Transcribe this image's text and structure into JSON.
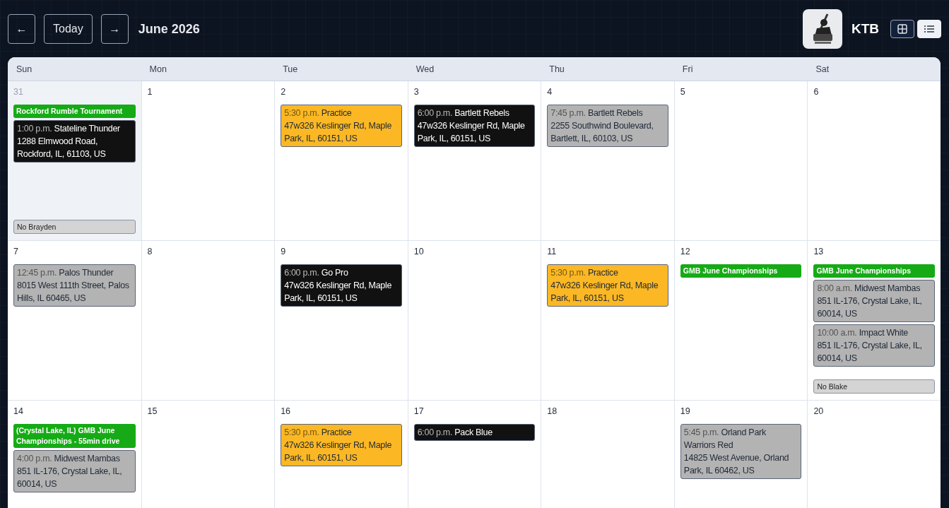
{
  "toolbar": {
    "prev": "←",
    "today": "Today",
    "next": "→",
    "title": "June 2026"
  },
  "team": {
    "name": "KTB"
  },
  "views": [
    {
      "kind": "grid",
      "selected": false
    },
    {
      "kind": "list",
      "selected": true
    }
  ],
  "weekdays": [
    "Sun",
    "Mon",
    "Tue",
    "Wed",
    "Thu",
    "Fri",
    "Sat"
  ],
  "weeks": [
    {
      "days": [
        {
          "day": "31",
          "outside": true,
          "events": [
            {
              "kind": "allday",
              "color": "#16ab16",
              "title": "Rockford Rumble Tournament"
            },
            {
              "kind": "timed",
              "color": "#111111",
              "time": "1:00 p.m.",
              "title": "Stateline Thunder",
              "address": "1288 Elmwood Road, Rockford, IL, 61103, US"
            },
            {
              "kind": "note",
              "title": "No Brayden"
            }
          ]
        },
        {
          "day": "1",
          "outside": false
        },
        {
          "day": "2",
          "outside": false,
          "events": [
            {
              "kind": "timed",
              "color": "#fbb824",
              "time": "5:30 p.m.",
              "title": "Practice",
              "address": "47w326 Keslinger Rd, Maple Park, IL, 60151, US"
            }
          ]
        },
        {
          "day": "3",
          "outside": false,
          "events": [
            {
              "kind": "timed",
              "color": "#111111",
              "time": "6:00 p.m.",
              "title": "Bartlett Rebels",
              "address": "47w326 Keslinger Rd, Maple Park, IL, 60151, US"
            }
          ]
        },
        {
          "day": "4",
          "outside": false,
          "events": [
            {
              "kind": "timed",
              "color": "#b3b3b3",
              "time": "7:45 p.m.",
              "title": "Bartlett Rebels",
              "address": "2255 Southwind Boulevard, Bartlett, IL, 60103, US"
            }
          ]
        },
        {
          "day": "5",
          "outside": false
        },
        {
          "day": "6",
          "outside": false
        }
      ]
    },
    {
      "days": [
        {
          "day": "7",
          "outside": false,
          "events": [
            {
              "kind": "timed",
              "color": "#b3b3b3",
              "time": "12:45 p.m.",
              "title": "Palos Thunder",
              "address": "8015 West 111th Street, Palos Hills, IL 60465, US"
            }
          ]
        },
        {
          "day": "8",
          "outside": false
        },
        {
          "day": "9",
          "outside": false,
          "events": [
            {
              "kind": "timed",
              "color": "#111111",
              "time": "6:00 p.m.",
              "title": "Go Pro",
              "address": "47w326 Keslinger Rd, Maple Park, IL, 60151, US"
            }
          ]
        },
        {
          "day": "10",
          "outside": false
        },
        {
          "day": "11",
          "outside": false,
          "events": [
            {
              "kind": "timed",
              "color": "#fbb824",
              "time": "5:30 p.m.",
              "title": "Practice",
              "address": "47w326 Keslinger Rd, Maple Park, IL, 60151, US"
            }
          ]
        },
        {
          "day": "12",
          "outside": false,
          "events": [
            {
              "kind": "allday",
              "color": "#16ab16",
              "title": "GMB June Championships"
            }
          ]
        },
        {
          "day": "13",
          "outside": false,
          "events": [
            {
              "kind": "allday",
              "color": "#16ab16",
              "title": "GMB June Championships"
            },
            {
              "kind": "timed",
              "color": "#b3b3b3",
              "time": "8:00 a.m.",
              "title": "Midwest Mambas",
              "address": "851 IL-176, Crystal Lake, IL, 60014, US"
            },
            {
              "kind": "timed",
              "color": "#b3b3b3",
              "time": "10:00 a.m.",
              "title": "Impact White",
              "address": "851 IL-176, Crystal Lake, IL, 60014, US"
            },
            {
              "kind": "note",
              "title": "No Blake"
            }
          ]
        }
      ]
    },
    {
      "days": [
        {
          "day": "14",
          "outside": false,
          "events": [
            {
              "kind": "allday",
              "color": "#16ab16",
              "title": "(Crystal Lake, IL) GMB June Championships - 55min drive"
            },
            {
              "kind": "timed",
              "color": "#b3b3b3",
              "time": "4:00 p.m.",
              "title": "Midwest Mambas",
              "address": "851 IL-176, Crystal Lake, IL, 60014, US"
            }
          ]
        },
        {
          "day": "15",
          "outside": false
        },
        {
          "day": "16",
          "outside": false,
          "events": [
            {
              "kind": "timed",
              "color": "#fbb824",
              "time": "5:30 p.m.",
              "title": "Practice",
              "address": "47w326 Keslinger Rd, Maple Park, IL, 60151, US"
            }
          ]
        },
        {
          "day": "17",
          "outside": false,
          "events": [
            {
              "kind": "timed",
              "color": "#111111",
              "time": "6:00 p.m.",
              "title": "Pack Blue"
            }
          ]
        },
        {
          "day": "18",
          "outside": false
        },
        {
          "day": "19",
          "outside": false,
          "events": [
            {
              "kind": "timed",
              "color": "#b3b3b3",
              "time": "5:45 p.m.",
              "title": "Orland Park Warriors Red",
              "address": "14825 West Avenue, Orland Park, IL 60462, US"
            }
          ]
        },
        {
          "day": "20",
          "outside": false
        }
      ]
    }
  ]
}
